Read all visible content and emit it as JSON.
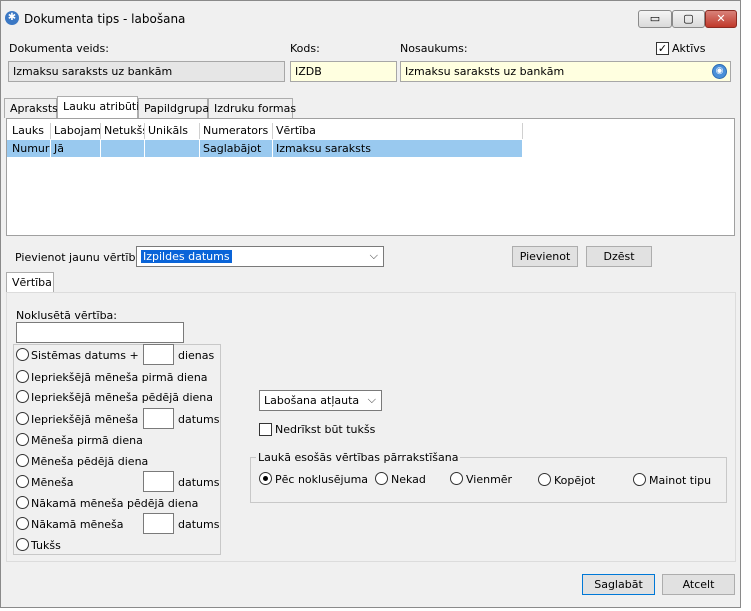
{
  "window": {
    "title": "Dokumenta tips - labošana",
    "minimize": "▭",
    "maximize": "▢",
    "close": "✕"
  },
  "header": {
    "doc_type_label": "Dokumenta veids:",
    "doc_type_value": "Izmaksu saraksts uz bankām",
    "code_label": "Kods:",
    "code_value": "IZDB",
    "name_label": "Nosaukums:",
    "name_value": "Izmaksu saraksts uz bankām",
    "active_label": "Aktīvs",
    "active_checked": true
  },
  "tabs": [
    {
      "label": "Apraksts",
      "active": false
    },
    {
      "label": "Lauku atribūti",
      "active": true
    },
    {
      "label": "Papildgrupas",
      "active": false
    },
    {
      "label": "Izdruku formas",
      "active": false
    }
  ],
  "grid": {
    "columns": [
      "Lauks",
      "Labojams",
      "Netukšs",
      "Unikāls",
      "Numerators",
      "Vērtība"
    ],
    "rows": [
      [
        "Numurs",
        "Jā",
        "",
        "",
        "Saglabājot",
        "Izmaksu saraksts"
      ]
    ]
  },
  "add_value": {
    "label": "Pievienot jaunu vērtību:",
    "selected": "Izpildes datums",
    "add_button": "Pievienot",
    "delete_button": "Dzēst"
  },
  "value_tab": {
    "label": "Vērtība"
  },
  "default_value": {
    "label": "Noklusētā vērtība:",
    "value": "",
    "options": [
      {
        "label": "Sistēmas datums +",
        "suffix": "dienas",
        "has_input": true
      },
      {
        "label": "Iepriekšējā mēneša pirmā diena",
        "suffix": "",
        "has_input": false
      },
      {
        "label": "Iepriekšējā mēneša pēdējā diena",
        "suffix": "",
        "has_input": false
      },
      {
        "label": "Iepriekšējā mēneša",
        "suffix": "datums",
        "has_input": true
      },
      {
        "label": "Mēneša pirmā diena",
        "suffix": "",
        "has_input": false
      },
      {
        "label": "Mēneša pēdējā diena",
        "suffix": "",
        "has_input": false
      },
      {
        "label": "Mēneša",
        "suffix": "datums",
        "has_input": true
      },
      {
        "label": "Nākamā mēneša pēdējā diena",
        "suffix": "",
        "has_input": false
      },
      {
        "label": "Nākamā mēneša",
        "suffix": "datums",
        "has_input": true
      },
      {
        "label": "Tukšs",
        "suffix": "",
        "has_input": false
      }
    ]
  },
  "editing": {
    "selected": "Labošana atļauta",
    "not_empty_label": "Nedrīkst būt tukšs",
    "not_empty_checked": false
  },
  "overwrite": {
    "title": "Laukā esošās vērtības pārrakstīšana",
    "options": [
      {
        "label": "Pēc noklusējuma",
        "checked": true
      },
      {
        "label": "Nekad",
        "checked": false
      },
      {
        "label": "Vienmēr",
        "checked": false
      },
      {
        "label": "Kopējot",
        "checked": false
      },
      {
        "label": "Mainot tipu",
        "checked": false
      }
    ]
  },
  "footer": {
    "save": "Saglabāt",
    "cancel": "Atcelt"
  }
}
